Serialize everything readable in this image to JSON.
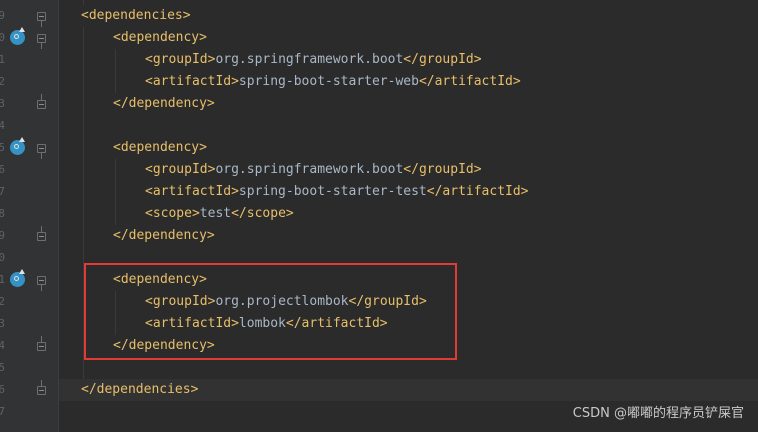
{
  "editor": {
    "line_numbers": [
      "9",
      "0",
      "1",
      "2",
      "3",
      "4",
      "5",
      "6",
      "7",
      "8",
      "9",
      "0",
      "1",
      "2",
      "3",
      "4",
      "5",
      "6",
      "7"
    ],
    "lines": [
      {
        "indent": 0,
        "open": "<dependencies>",
        "text": "",
        "close": ""
      },
      {
        "indent": 1,
        "open": "<dependency>",
        "text": "",
        "close": ""
      },
      {
        "indent": 2,
        "open": "<groupId>",
        "text": "org.springframework.boot",
        "close": "</groupId>"
      },
      {
        "indent": 2,
        "open": "<artifactId>",
        "text": "spring-boot-starter-web",
        "close": "</artifactId>"
      },
      {
        "indent": 1,
        "open": "</dependency>",
        "text": "",
        "close": ""
      },
      {
        "indent": 0,
        "open": "",
        "text": "",
        "close": ""
      },
      {
        "indent": 1,
        "open": "<dependency>",
        "text": "",
        "close": ""
      },
      {
        "indent": 2,
        "open": "<groupId>",
        "text": "org.springframework.boot",
        "close": "</groupId>"
      },
      {
        "indent": 2,
        "open": "<artifactId>",
        "text": "spring-boot-starter-test",
        "close": "</artifactId>"
      },
      {
        "indent": 2,
        "open": "<scope>",
        "text": "test",
        "close": "</scope>"
      },
      {
        "indent": 1,
        "open": "</dependency>",
        "text": "",
        "close": ""
      },
      {
        "indent": 0,
        "open": "",
        "text": "",
        "close": ""
      },
      {
        "indent": 1,
        "open": "<dependency>",
        "text": "",
        "close": ""
      },
      {
        "indent": 2,
        "open": "<groupId>",
        "text": "org.projectlombok",
        "close": "</groupId>"
      },
      {
        "indent": 2,
        "open": "<artifactId>",
        "text": "lombok",
        "close": "</artifactId>"
      },
      {
        "indent": 1,
        "open": "</dependency>",
        "text": "",
        "close": ""
      },
      {
        "indent": 0,
        "open": "",
        "text": "",
        "close": ""
      },
      {
        "indent": 0,
        "open": "</dependencies>",
        "text": "",
        "close": ""
      }
    ]
  },
  "watermark": "CSDN @嘟嘟的程序员铲屎官",
  "colors": {
    "background": "#2b2b2b",
    "gutter": "#313335",
    "tag": "#e8bf6a",
    "text": "#a9b7c6",
    "highlight_box": "#e53935",
    "run_icon": "#3592c4"
  },
  "icons": {
    "run_icon": "maven-dependency-update-icon",
    "fold_icon": "fold-marker-icon"
  }
}
